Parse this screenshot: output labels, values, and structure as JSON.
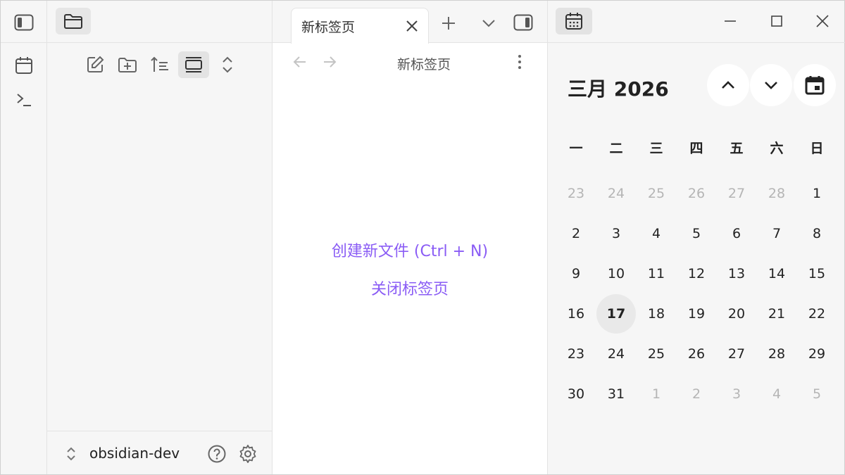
{
  "editor": {
    "tab_title": "新标签页",
    "view_title": "新标签页",
    "actions": [
      "创建新文件 (Ctrl + N)",
      "关闭标签页"
    ]
  },
  "explorer": {
    "vault_name": "obsidian-dev"
  },
  "calendar": {
    "month_title": "三月 2026",
    "weekdays": [
      "一",
      "二",
      "三",
      "四",
      "五",
      "六",
      "日"
    ],
    "weeks": [
      [
        {
          "d": "23",
          "m": true
        },
        {
          "d": "24",
          "m": true
        },
        {
          "d": "25",
          "m": true
        },
        {
          "d": "26",
          "m": true
        },
        {
          "d": "27",
          "m": true
        },
        {
          "d": "28",
          "m": true
        },
        {
          "d": "1"
        }
      ],
      [
        {
          "d": "2"
        },
        {
          "d": "3"
        },
        {
          "d": "4"
        },
        {
          "d": "5"
        },
        {
          "d": "6"
        },
        {
          "d": "7"
        },
        {
          "d": "8"
        }
      ],
      [
        {
          "d": "9"
        },
        {
          "d": "10"
        },
        {
          "d": "11"
        },
        {
          "d": "12"
        },
        {
          "d": "13"
        },
        {
          "d": "14"
        },
        {
          "d": "15"
        }
      ],
      [
        {
          "d": "16"
        },
        {
          "d": "17",
          "today": true
        },
        {
          "d": "18"
        },
        {
          "d": "19"
        },
        {
          "d": "20"
        },
        {
          "d": "21"
        },
        {
          "d": "22"
        }
      ],
      [
        {
          "d": "23"
        },
        {
          "d": "24"
        },
        {
          "d": "25"
        },
        {
          "d": "26"
        },
        {
          "d": "27"
        },
        {
          "d": "28"
        },
        {
          "d": "29"
        }
      ],
      [
        {
          "d": "30"
        },
        {
          "d": "31"
        },
        {
          "d": "1",
          "m": true
        },
        {
          "d": "2",
          "m": true
        },
        {
          "d": "3",
          "m": true
        },
        {
          "d": "4",
          "m": true
        },
        {
          "d": "5",
          "m": true
        }
      ]
    ]
  },
  "icons": {
    "ribbon": [
      "sidebar-toggle-icon",
      "calendar-icon",
      "terminal-icon"
    ],
    "explorer_top": [
      "folder-icon"
    ],
    "explorer_toolbar": [
      "new-note-icon",
      "new-folder-icon",
      "sort-icon",
      "auto-reveal-icon",
      "collapse-all-icon"
    ],
    "tabbar": [
      "new-tab-icon",
      "tab-list-icon",
      "right-sidebar-toggle-icon"
    ],
    "view_header": [
      "back-arrow-icon",
      "forward-arrow-icon",
      "more-options-icon"
    ],
    "window": [
      "minimize-icon",
      "maximize-icon",
      "close-window-icon"
    ],
    "vault": [
      "vault-switcher-icon",
      "help-icon",
      "settings-icon"
    ]
  },
  "colors": {
    "accent": "#8a5cf5",
    "muted_day": "#b5b5b5",
    "background": "#f6f6f6"
  }
}
